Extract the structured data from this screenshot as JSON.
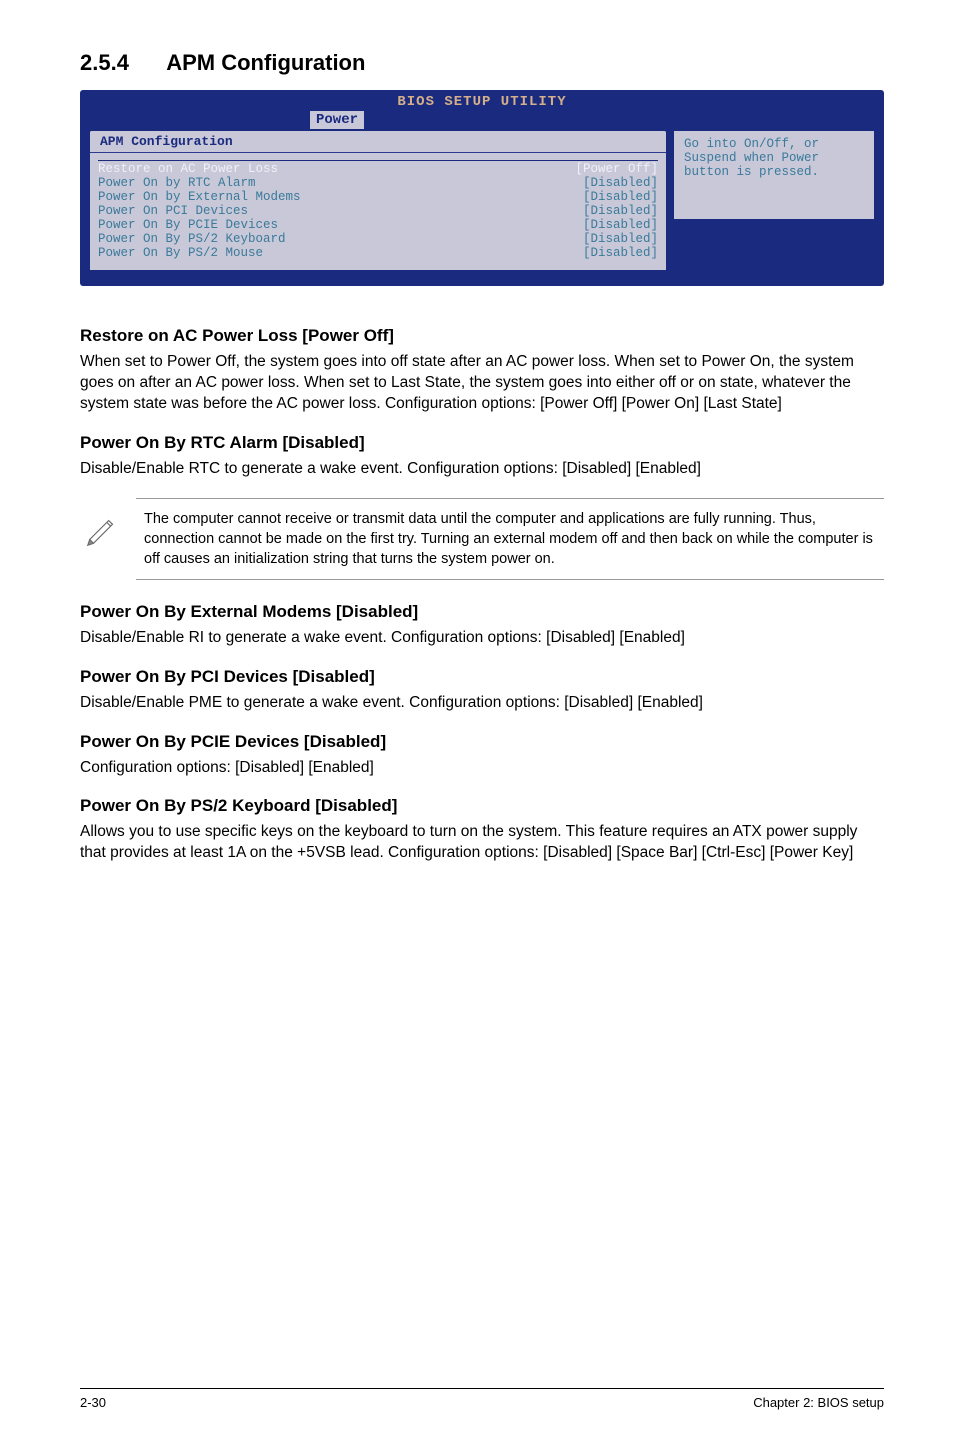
{
  "section": {
    "number": "2.5.4",
    "title": "APM Configuration"
  },
  "bios": {
    "utility_title": "BIOS SETUP UTILITY",
    "tab": "Power",
    "panel_title": "APM Configuration",
    "rows": [
      {
        "label": "Restore on AC Power Loss",
        "value": "[Power Off]"
      },
      {
        "label": "Power On by RTC Alarm",
        "value": "[Disabled]"
      },
      {
        "label": "Power On by External Modems",
        "value": "[Disabled]"
      },
      {
        "label": "Power On PCI Devices",
        "value": "[Disabled]"
      },
      {
        "label": "Power On By PCIE Devices",
        "value": "[Disabled]"
      },
      {
        "label": "Power On By PS/2 Keyboard",
        "value": "[Disabled]"
      },
      {
        "label": "Power On By PS/2 Mouse",
        "value": "[Disabled]"
      }
    ],
    "help": "Go into On/Off, or Suspend when Power button is pressed."
  },
  "sections": {
    "restore": {
      "heading": "Restore on AC Power Loss [Power Off]",
      "body": "When set to Power Off, the system goes into off state after an AC power loss. When set to Power On, the system goes on after an AC power loss. When set to Last State, the system goes into either off or on state, whatever the system state was before the AC power loss. Configuration options: [Power Off] [Power On] [Last State]"
    },
    "rtc": {
      "heading": "Power On By RTC Alarm [Disabled]",
      "body": "Disable/Enable RTC to generate a wake event. Configuration options: [Disabled] [Enabled]"
    },
    "note": {
      "body": "The computer cannot receive or transmit data until the computer and applications are fully running. Thus, connection cannot be made on the first try. Turning an external modem off and then back on while the computer is off causes an initialization string that turns the system power on."
    },
    "ext": {
      "heading": "Power On By External Modems [Disabled]",
      "body": "Disable/Enable RI to generate a wake event. Configuration options: [Disabled] [Enabled]"
    },
    "pci": {
      "heading": "Power On By PCI Devices [Disabled]",
      "body": "Disable/Enable PME to generate a wake event.  Configuration options: [Disabled] [Enabled]"
    },
    "pcie": {
      "heading": "Power On By PCIE Devices [Disabled]",
      "body": "Configuration options: [Disabled] [Enabled]"
    },
    "ps2": {
      "heading": "Power On By PS/2 Keyboard [Disabled]",
      "body": "Allows you to use specific keys on the keyboard to turn on the system. This feature requires an ATX power supply that provides at least 1A on the +5VSB lead. Configuration options: [Disabled] [Space Bar] [Ctrl-Esc] [Power Key]"
    }
  },
  "footer": {
    "left": "2-30",
    "right": "Chapter 2: BIOS setup"
  }
}
